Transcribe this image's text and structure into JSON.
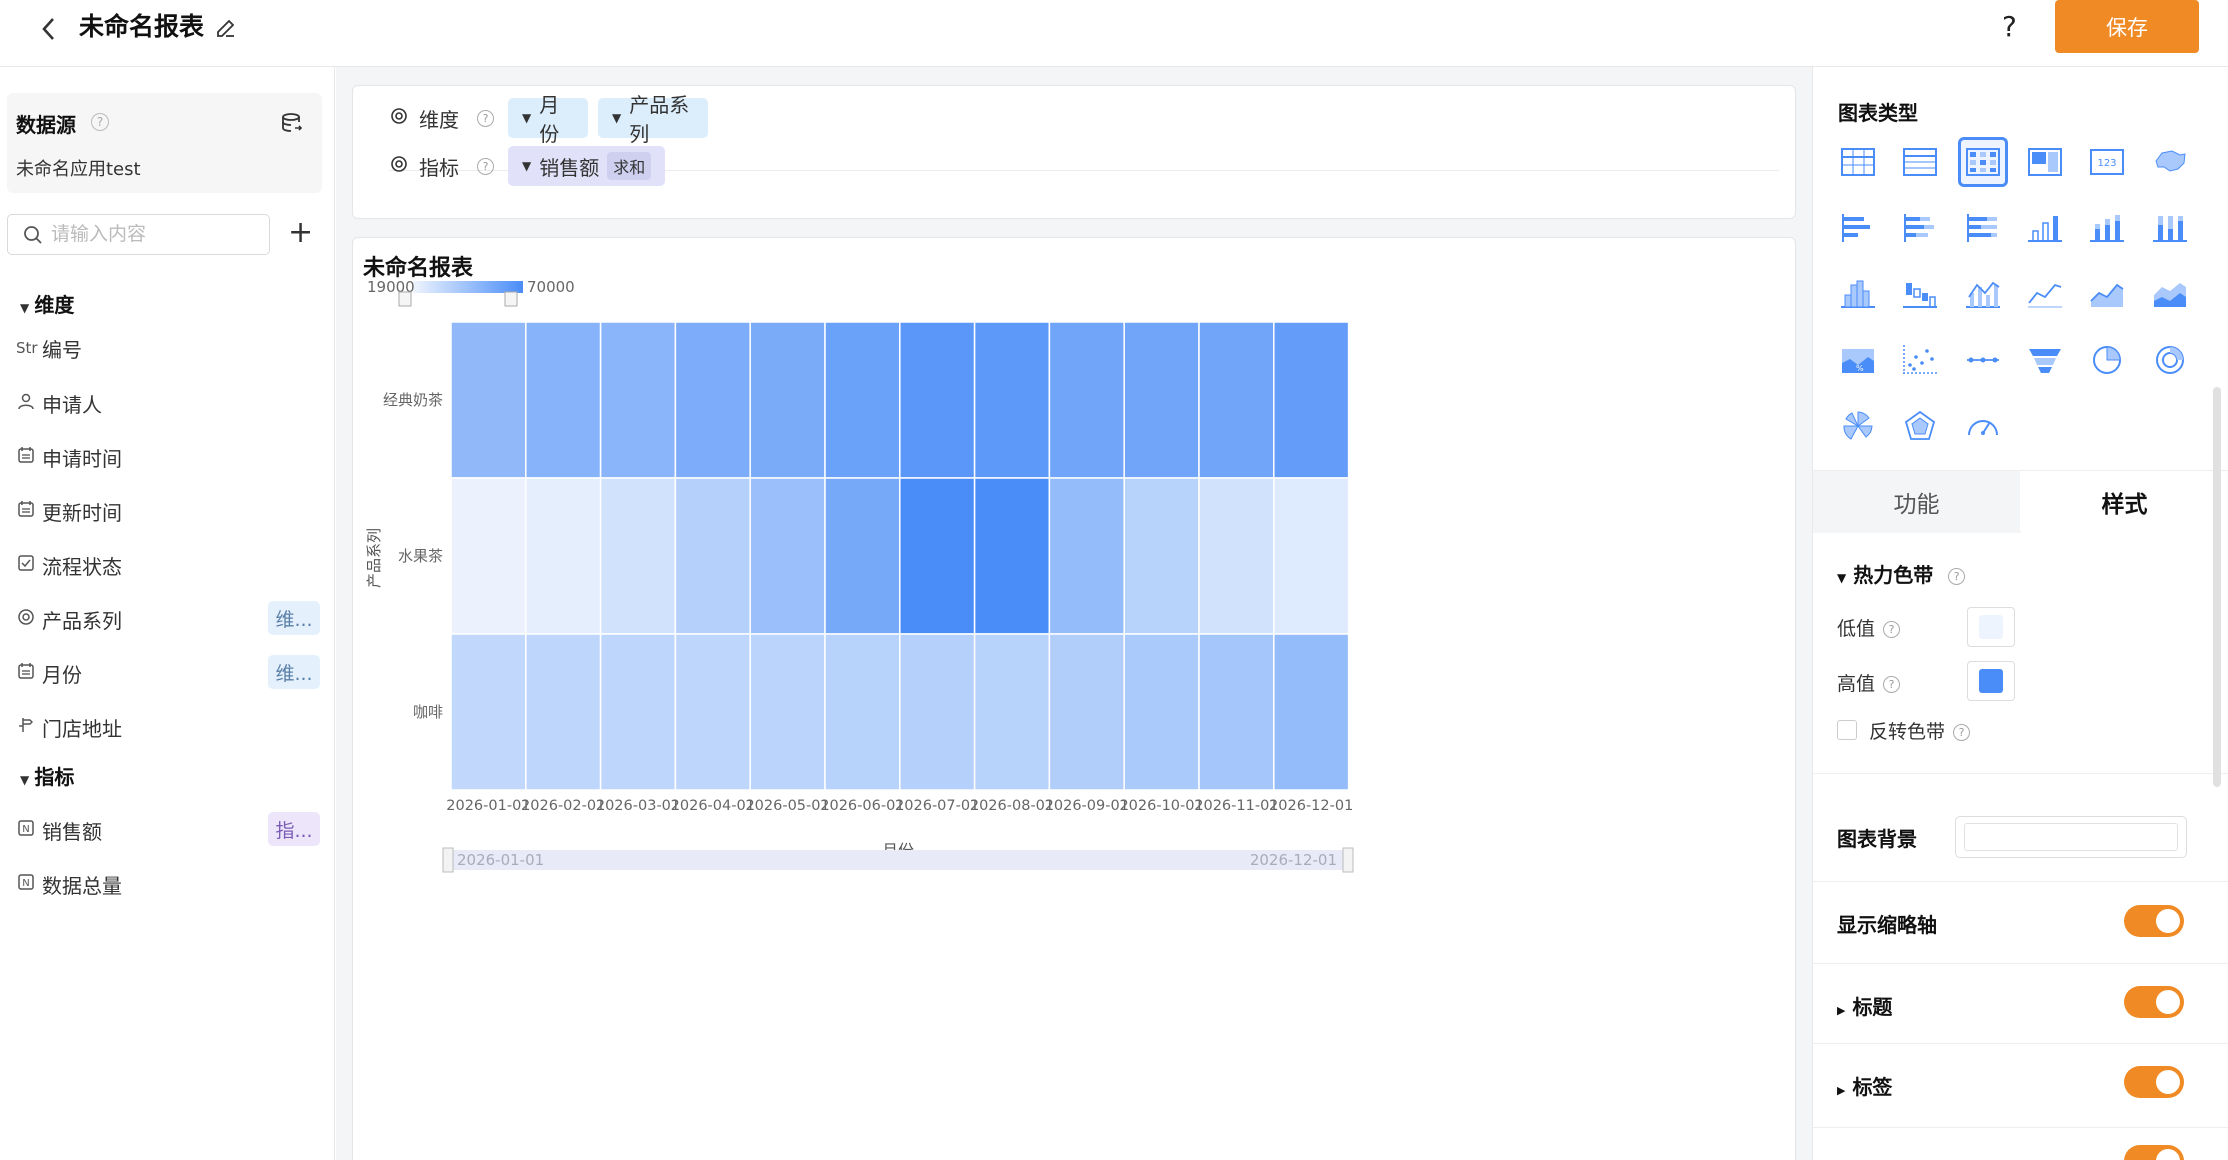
{
  "header": {
    "title": "未命名报表",
    "help": "?",
    "save_label": "保存"
  },
  "datasource": {
    "title": "数据源",
    "name": "未命名应用test",
    "search_placeholder": "请输入内容"
  },
  "dimensions": {
    "title": "维度",
    "items": [
      {
        "icon": "Str",
        "label": "编号",
        "tag": ""
      },
      {
        "icon": "person-icon",
        "label": "申请人",
        "tag": ""
      },
      {
        "icon": "calendar-icon",
        "label": "申请时间",
        "tag": ""
      },
      {
        "icon": "calendar-icon",
        "label": "更新时间",
        "tag": ""
      },
      {
        "icon": "checkbox-icon",
        "label": "流程状态",
        "tag": ""
      },
      {
        "icon": "radio-icon",
        "label": "产品系列",
        "tag": "维..."
      },
      {
        "icon": "calendar-icon",
        "label": "月份",
        "tag": "维..."
      },
      {
        "icon": "location-icon",
        "label": "门店地址",
        "tag": ""
      }
    ]
  },
  "metrics": {
    "title": "指标",
    "items": [
      {
        "icon": "N",
        "label": "销售额",
        "tag": "指..."
      },
      {
        "icon": "N",
        "label": "数据总量",
        "tag": ""
      }
    ]
  },
  "config": {
    "dim_label": "维度",
    "dim_pills": [
      "月份",
      "产品系列"
    ],
    "metric_label": "指标",
    "metric_pill": "销售额",
    "metric_agg": "求和"
  },
  "chart": {
    "title": "未命名报表"
  },
  "chart_data": {
    "type": "heatmap",
    "x": [
      "2026-01-01",
      "2026-02-01",
      "2026-03-01",
      "2026-04-01",
      "2026-05-01",
      "2026-06-01",
      "2026-07-01",
      "2026-08-01",
      "2026-09-01",
      "2026-10-01",
      "2026-11-01",
      "2026-12-01"
    ],
    "y": [
      "经典奶茶",
      "水果茶",
      "咖啡"
    ],
    "values": [
      [
        48000,
        51000,
        50000,
        54000,
        55000,
        60000,
        65000,
        64000,
        58000,
        58000,
        58000,
        62000
      ],
      [
        20000,
        22000,
        28000,
        37000,
        45000,
        56000,
        70000,
        70000,
        47000,
        36000,
        28000,
        24000
      ],
      [
        33000,
        34000,
        34000,
        34000,
        35000,
        36000,
        37000,
        36000,
        38000,
        40000,
        42000,
        47000
      ]
    ],
    "xlabel": "月份",
    "ylabel": "产品系列",
    "range_min": "19000",
    "range_max": "70000",
    "zoom_start": "2026-01-01",
    "zoom_end": "2026-12-01",
    "low_color": "#eef4fd",
    "high_color": "#4a8df8"
  },
  "right_panel": {
    "chart_type_title": "图表类型",
    "chart_type_icons": [
      "table-icon",
      "detail-table-icon",
      "heatmap-icon",
      "treemap-icon",
      "kpi-card-icon",
      "map-icon",
      "bar-h-icon",
      "stacked-bar-h-icon",
      "percent-bar-h-icon",
      "column-icon",
      "stacked-column-icon",
      "percent-column-icon",
      "histogram-icon",
      "waterfall-icon",
      "combo-icon",
      "line-icon",
      "area-icon",
      "stacked-area-icon",
      "percent-area-icon",
      "scatter-icon",
      "timeline-icon",
      "funnel-icon",
      "pie-icon",
      "ring-icon",
      "rose-icon",
      "radar-icon",
      "gauge-icon"
    ],
    "kpi_icon_text": "123",
    "tabs": [
      "功能",
      "样式"
    ],
    "heat_band_title": "热力色带",
    "low_label": "低值",
    "high_label": "高值",
    "reverse_label": "反转色带",
    "chart_bg_label": "图表背景",
    "show_zoom_label": "显示缩略轴",
    "title_label": "标题",
    "label_label": "标签"
  }
}
